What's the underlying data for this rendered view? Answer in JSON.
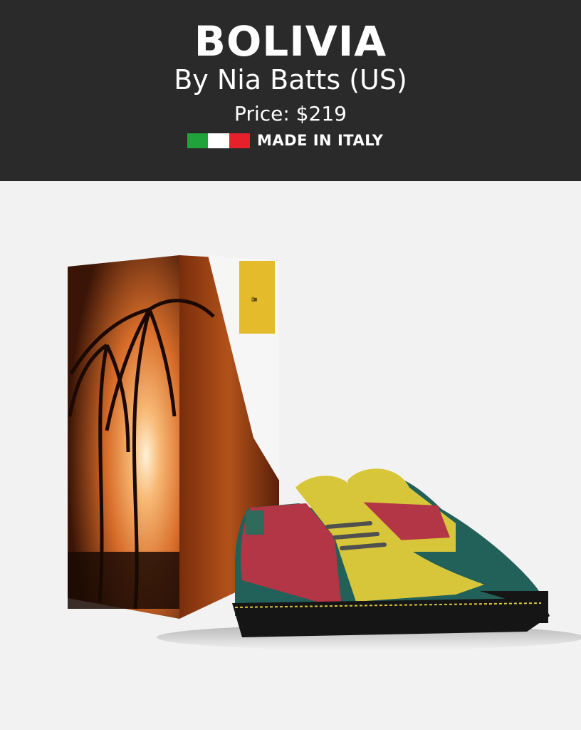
{
  "header": {
    "title": "BOLIVIA",
    "byline": "By Nia Batts (US)",
    "price": "Price: $219",
    "made_in": "MADE IN ITALY",
    "flag_colors": [
      "#1fa33a",
      "#ffffff",
      "#e8202a"
    ]
  },
  "colors": {
    "header_bg": "#2a2a2a",
    "page_bg": "#f2f2f2",
    "box_sunset": "#d9732a",
    "box_label": "#e3bb2b",
    "shoe_red": "#b23645",
    "shoe_yellow": "#d8c63a",
    "shoe_green": "#22605a",
    "sole": "#151515"
  },
  "product": {
    "image_description": "",
    "icons": [
      "italy-flag-icon",
      "crown-logo-icon"
    ]
  }
}
